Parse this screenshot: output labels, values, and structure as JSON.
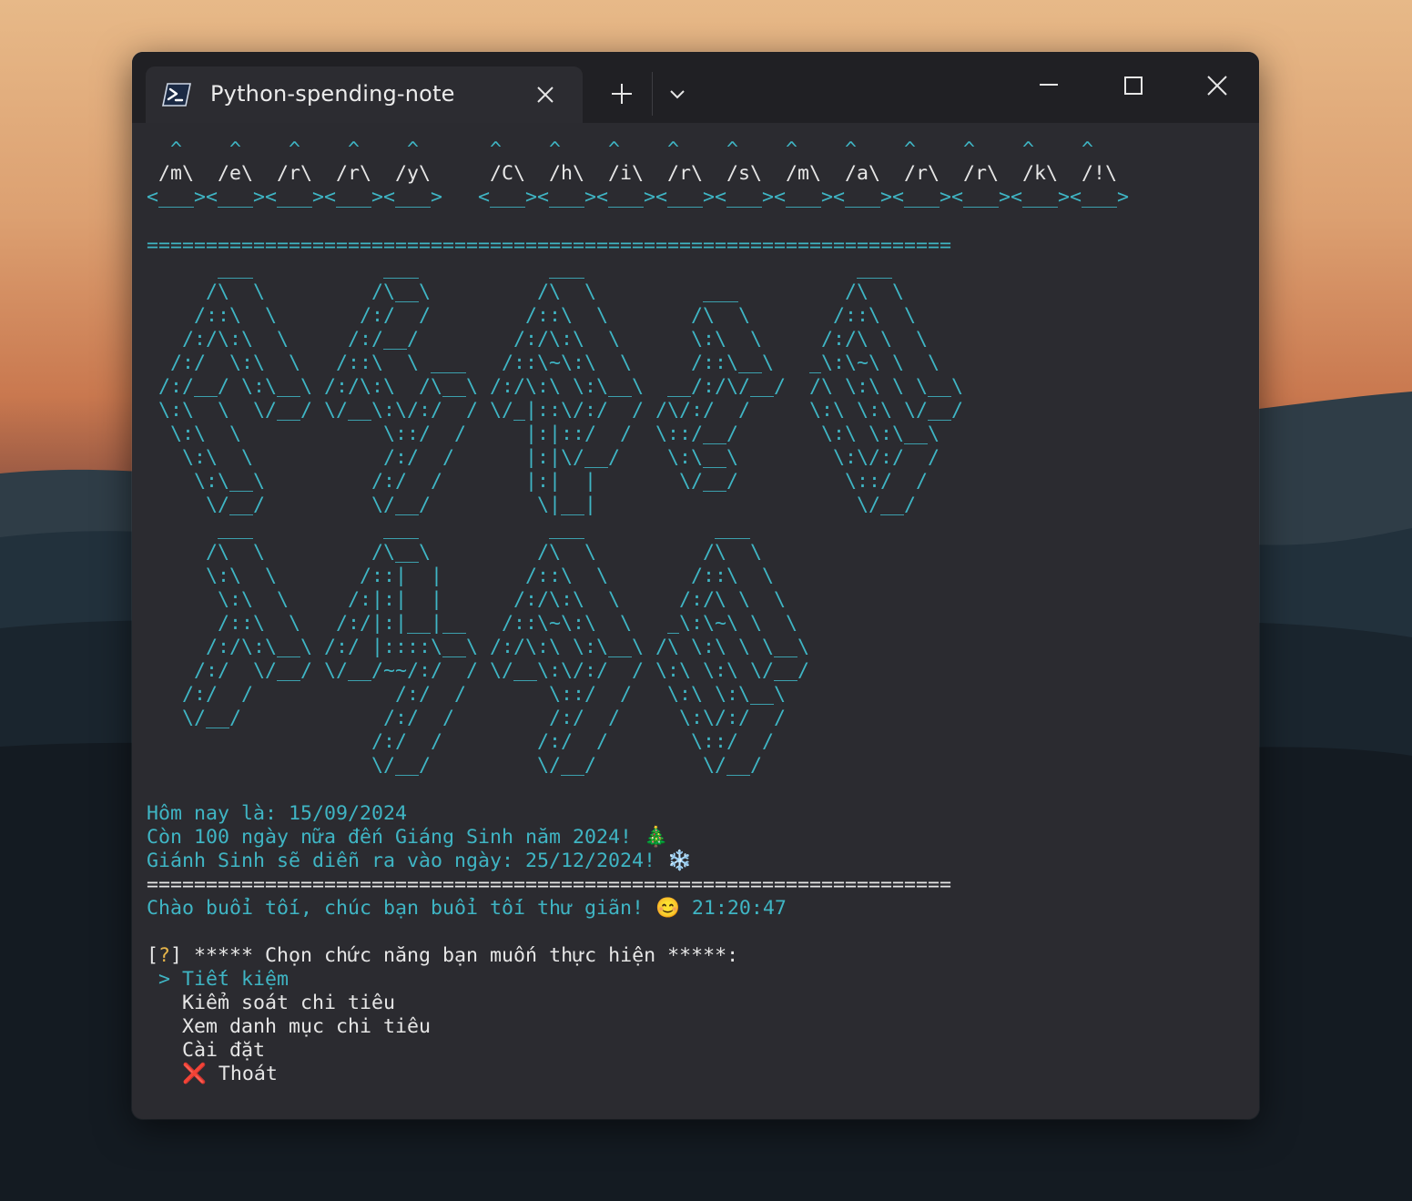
{
  "tab": {
    "title": "Python-spending-note",
    "icon": "powershell-icon"
  },
  "window_controls": {
    "minimize": "minimize-icon",
    "maximize": "maximize-icon",
    "close": "close-icon"
  },
  "colors": {
    "accent": "#3fb5c4",
    "text": "#e6e6e6",
    "question_mark": "#e8b64a",
    "terminal_bg": "#2b2b30"
  },
  "banner_small": {
    "carets": "  ^    ^    ^    ^    ^      ^    ^    ^    ^    ^    ^    ^    ^    ^    ^    ^",
    "letters": " /m\\  /e\\  /r\\  /r\\  /y\\     /C\\  /h\\  /i\\  /r\\  /s\\  /m\\  /a\\  /r\\  /r\\  /k\\  /!\\",
    "base": "<___><___><___><___><___>   <___><___><___><___><___><___><___><___><___><___><___>"
  },
  "separator": "====================================================================",
  "ascii_art": [
    "      ___           ___           ___                       ___",
    "     /\\  \\         /\\__\\         /\\  \\         ___         /\\  \\",
    "    /::\\  \\       /:/  /        /::\\  \\       /\\  \\       /::\\  \\",
    "   /:/\\:\\  \\     /:/__/        /:/\\:\\  \\      \\:\\  \\     /:/\\ \\  \\",
    "  /:/  \\:\\  \\   /::\\  \\ ___   /::\\~\\:\\  \\     /::\\__\\   _\\:\\~\\ \\  \\",
    " /:/__/ \\:\\__\\ /:/\\:\\  /\\__\\ /:/\\:\\ \\:\\__\\  __/:/\\/__/  /\\ \\:\\ \\ \\__\\",
    " \\:\\  \\  \\/__/ \\/__\\:\\/:/  / \\/_|::\\/:/  / /\\/:/  /     \\:\\ \\:\\ \\/__/",
    "  \\:\\  \\            \\::/  /     |:|::/  /  \\::/__/       \\:\\ \\:\\__\\",
    "   \\:\\  \\           /:/  /      |:|\\/__/    \\:\\__\\        \\:\\/:/  /",
    "    \\:\\__\\         /:/  /       |:|  |       \\/__/         \\::/  /",
    "     \\/__/         \\/__/         \\|__|                      \\/__/",
    "      ___           ___           ___           ___",
    "     /\\  \\         /\\__\\         /\\  \\         /\\  \\",
    "     \\:\\  \\       /::|  |       /::\\  \\       /::\\  \\",
    "      \\:\\  \\     /:|:|  |      /:/\\:\\  \\     /:/\\ \\  \\",
    "      /::\\  \\   /:/|:|__|__   /::\\~\\:\\  \\   _\\:\\~\\ \\  \\",
    "     /:/\\:\\__\\ /:/ |::::\\__\\ /:/\\:\\ \\:\\__\\ /\\ \\:\\ \\ \\__\\",
    "    /:/  \\/__/ \\/__/~~/:/  / \\/__\\:\\/:/  / \\:\\ \\:\\ \\/__/",
    "   /:/  /            /:/  /       \\::/  /   \\:\\ \\:\\__\\",
    "   \\/__/            /:/  /        /:/  /     \\:\\/:/  /",
    "                   /:/  /        /:/  /       \\::/  /",
    "                   \\/__/         \\/__/         \\/__/"
  ],
  "info": {
    "today": "Hôm nay là: 15/09/2024",
    "countdown": "Còn 100 ngày nữa đến Giáng Sinh năm 2024! 🎄",
    "christmas": "Giánh Sinh sẽ diễn ra vào ngày: 25/12/2024! ❄️",
    "greeting": "Chào buổi tối, chúc bạn buổi tối thư giãn! 😊 21:20:47"
  },
  "prompt": {
    "bracket_open": "[",
    "mark": "?",
    "bracket_close": "]",
    "question": " ***** Chọn chức năng bạn muốn thực hiện *****:"
  },
  "menu": {
    "pointer": " > ",
    "items": [
      "Tiết kiệm",
      "Kiểm soát chi tiêu",
      "Xem danh mục chi tiêu",
      "Cài đặt",
      "❌ Thoát"
    ],
    "selected_index": 0
  }
}
